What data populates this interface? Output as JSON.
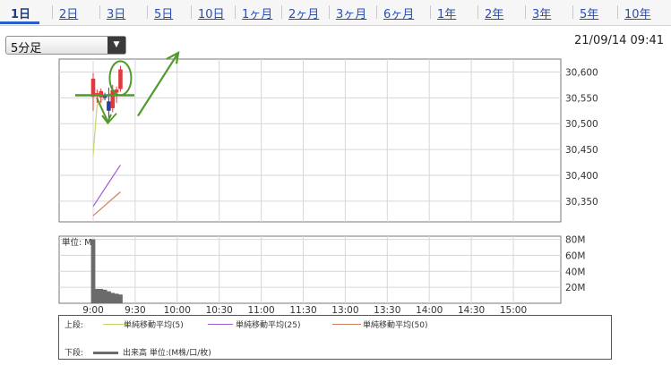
{
  "tabs": [
    "1日",
    "2日",
    "3日",
    "5日",
    "10日",
    "1ヶ月",
    "2ヶ月",
    "3ヶ月",
    "6ヶ月",
    "1年",
    "2年",
    "3年",
    "5年",
    "10年"
  ],
  "active_tab": "1日",
  "interval": {
    "selected": "5分足"
  },
  "timestamp": "21/09/14 09:41",
  "colors": {
    "up": "#e0393e",
    "down": "#2c3e99",
    "ma5": "#c9d36a",
    "ma25": "#a55ad6",
    "ma50": "#d27f5f",
    "volume": "#6b6b6b",
    "annotation": "#4f9a2a"
  },
  "chart_data": [
    {
      "type": "candlestick",
      "y_tick_labels": [
        "30,600",
        "30,550",
        "30,500",
        "30,450",
        "30,400",
        "30,350"
      ],
      "ylim": [
        30310,
        30625
      ],
      "grid": true,
      "candles": [
        {
          "time": "9:00",
          "open": 30552,
          "high": 30598,
          "low": 30525,
          "close": 30587
        },
        {
          "time": "9:05",
          "open": 30555,
          "high": 30566,
          "low": 30540,
          "close": 30559
        },
        {
          "time": "9:10",
          "open": 30551,
          "high": 30568,
          "low": 30540,
          "close": 30563
        },
        {
          "time": "9:15",
          "open": 30556,
          "high": 30560,
          "low": 30545,
          "close": 30550
        },
        {
          "time": "9:20",
          "open": 30543,
          "high": 30570,
          "low": 30505,
          "close": 30525
        },
        {
          "time": "9:25",
          "open": 30530,
          "high": 30575,
          "low": 30522,
          "close": 30565
        },
        {
          "time": "9:30",
          "open": 30560,
          "high": 30572,
          "low": 30540,
          "close": 30566
        },
        {
          "time": "9:35",
          "open": 30567,
          "high": 30612,
          "low": 30562,
          "close": 30605
        }
      ],
      "moving_averages": [
        {
          "name": "単純移動平均(5)",
          "points": [
            [
              "9:00",
              30440
            ],
            [
              "9:05",
              30535
            ],
            [
              "9:10",
              30545
            ],
            [
              "9:15",
              30549
            ],
            [
              "9:20",
              30557
            ],
            [
              "9:25",
              30560
            ],
            [
              "9:30",
              30562
            ]
          ]
        },
        {
          "name": "単純移動平均(25)",
          "points": [
            [
              "9:00",
              30340
            ],
            [
              "9:35",
              30420
            ]
          ]
        },
        {
          "name": "単純移動平均(50)",
          "points": [
            [
              "9:00",
              30322
            ],
            [
              "9:35",
              30368
            ]
          ]
        }
      ]
    },
    {
      "type": "bar",
      "unit_label": "単位: M",
      "y_tick_labels": [
        "80M",
        "60M",
        "40M",
        "20M"
      ],
      "ylim": [
        0,
        84
      ],
      "categories": [
        "9:00",
        "9:05",
        "9:10",
        "9:15",
        "9:20",
        "9:25",
        "9:30",
        "9:35"
      ],
      "values": [
        80,
        18,
        18,
        17,
        15,
        13,
        12,
        11
      ]
    }
  ],
  "x_tick_labels": [
    "9:00",
    "9:30",
    "10:00",
    "10:30",
    "11:00",
    "11:30",
    "13:00",
    "13:30",
    "14:00",
    "14:30",
    "15:00"
  ],
  "legend": {
    "upper_label": "上段:",
    "upper_items": [
      "単純移動平均(5)",
      "単純移動平均(25)",
      "単純移動平均(50)"
    ],
    "lower_label": "下段:",
    "lower_item": "出来高 単位:(M株/口/枚)"
  }
}
